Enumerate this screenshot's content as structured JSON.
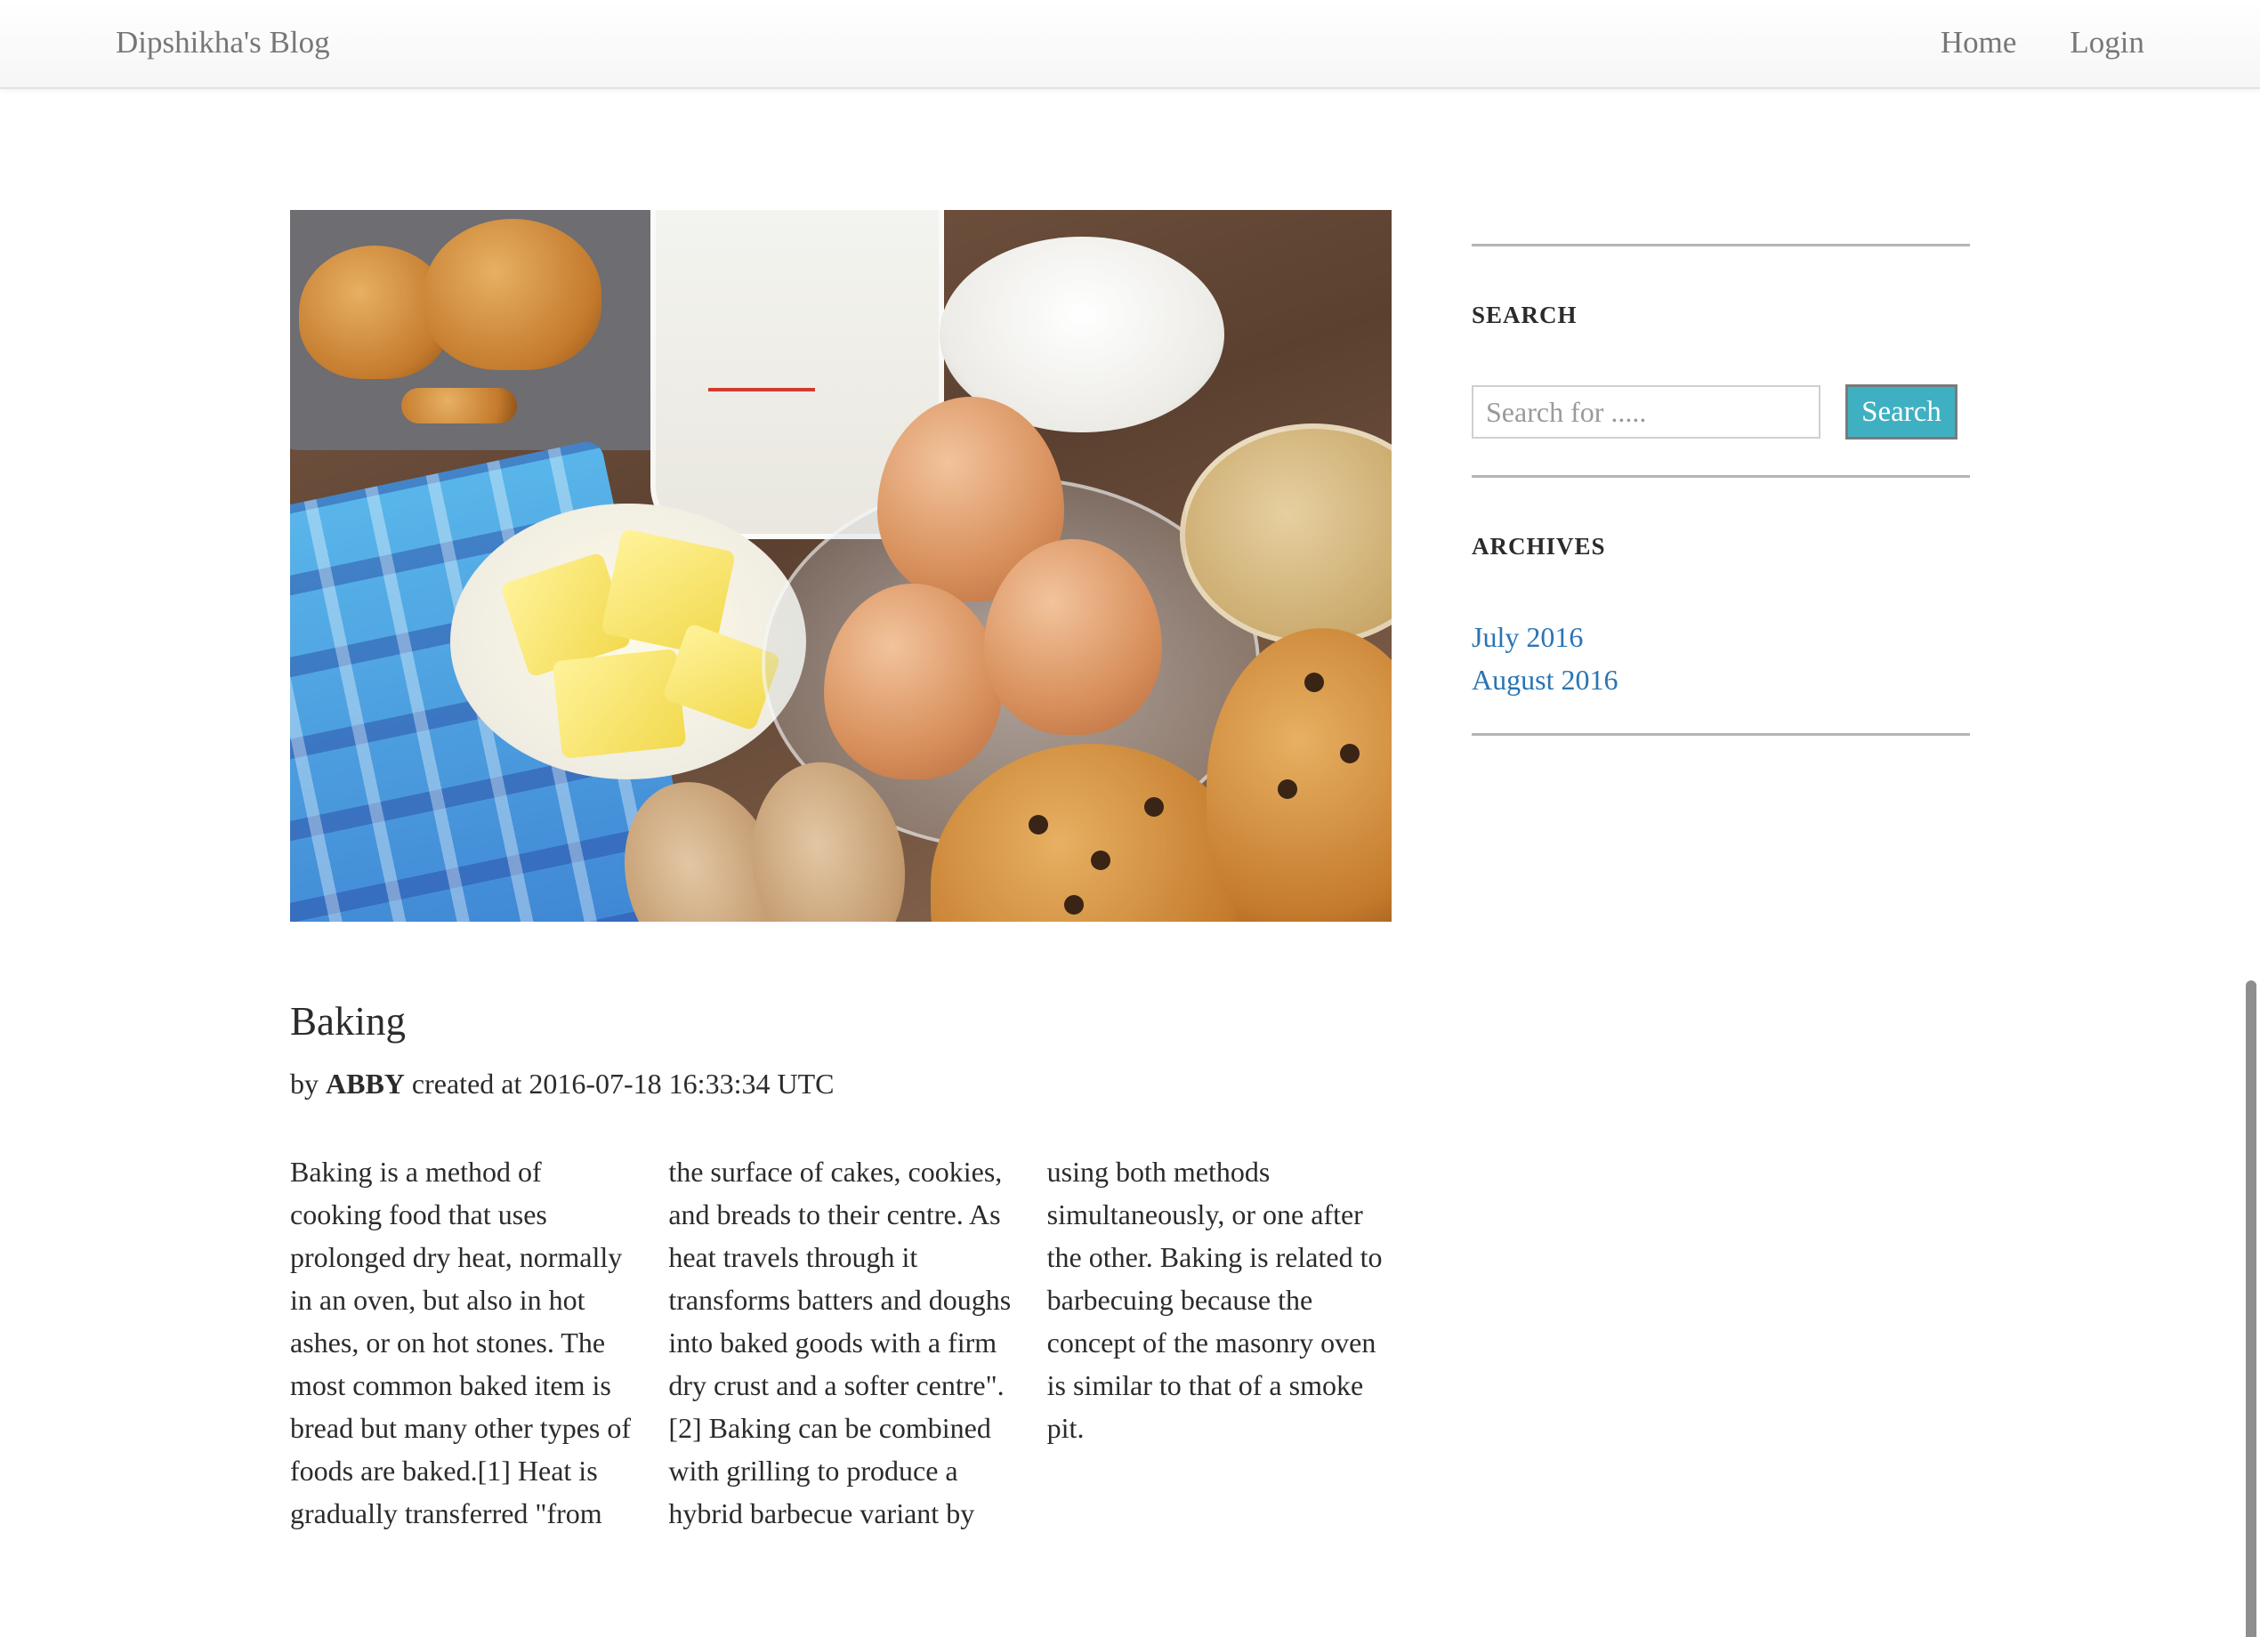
{
  "navbar": {
    "brand": "Dipshikha's Blog",
    "links": [
      "Home",
      "Login"
    ]
  },
  "post": {
    "image_alt": "Baking ingredients: muffins, milk measuring cup, butter, eggs, flour, sugar",
    "title": "Baking",
    "meta": {
      "by_label": "by",
      "author": "ABBY",
      "created_label": "created at",
      "timestamp": "2016-07-18 16:33:34 UTC"
    },
    "body": "Baking is a method of cooking food that uses prolonged dry heat, normally in an oven, but also in hot ashes, or on hot stones. The most common baked item is bread but many other types of foods are baked.[1] Heat is gradually transferred \"from the surface of cakes, cookies, and breads to their centre. As heat travels through it transforms batters and doughs into baked goods with a firm dry crust and a softer centre\".[2] Baking can be combined with grilling to produce a hybrid barbecue variant by using both methods simultaneously, or one after the other. Baking is related to barbecuing because the concept of the masonry oven is similar to that of a smoke pit."
  },
  "sidebar": {
    "search": {
      "heading": "SEARCH",
      "placeholder": "Search for .....",
      "value": "",
      "button_label": "Search"
    },
    "archives": {
      "heading": "ARCHIVES",
      "items": [
        "July 2016",
        "August 2016"
      ]
    }
  },
  "colors": {
    "accent_button": "#3fb0c2",
    "link": "#2a74b4",
    "nav_text": "#777777"
  }
}
